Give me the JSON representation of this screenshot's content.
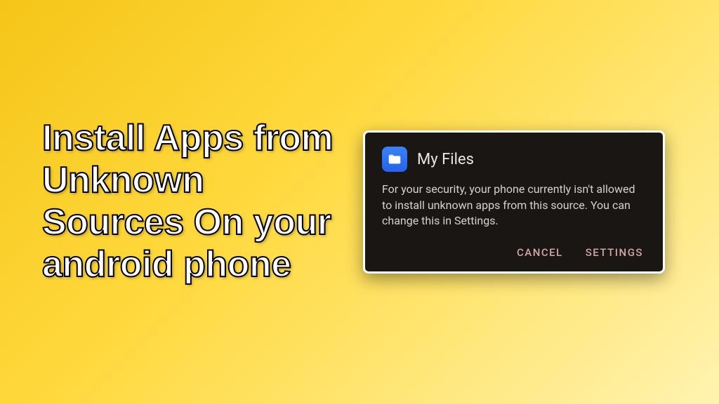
{
  "headline": "Install Apps from Unknown Sources On your android phone",
  "dialog": {
    "app_name": "My Files",
    "message": "For your security, your phone currently isn't allowed to install unknown apps from this source. You can change this in Settings.",
    "cancel_label": "CANCEL",
    "settings_label": "SETTINGS"
  }
}
